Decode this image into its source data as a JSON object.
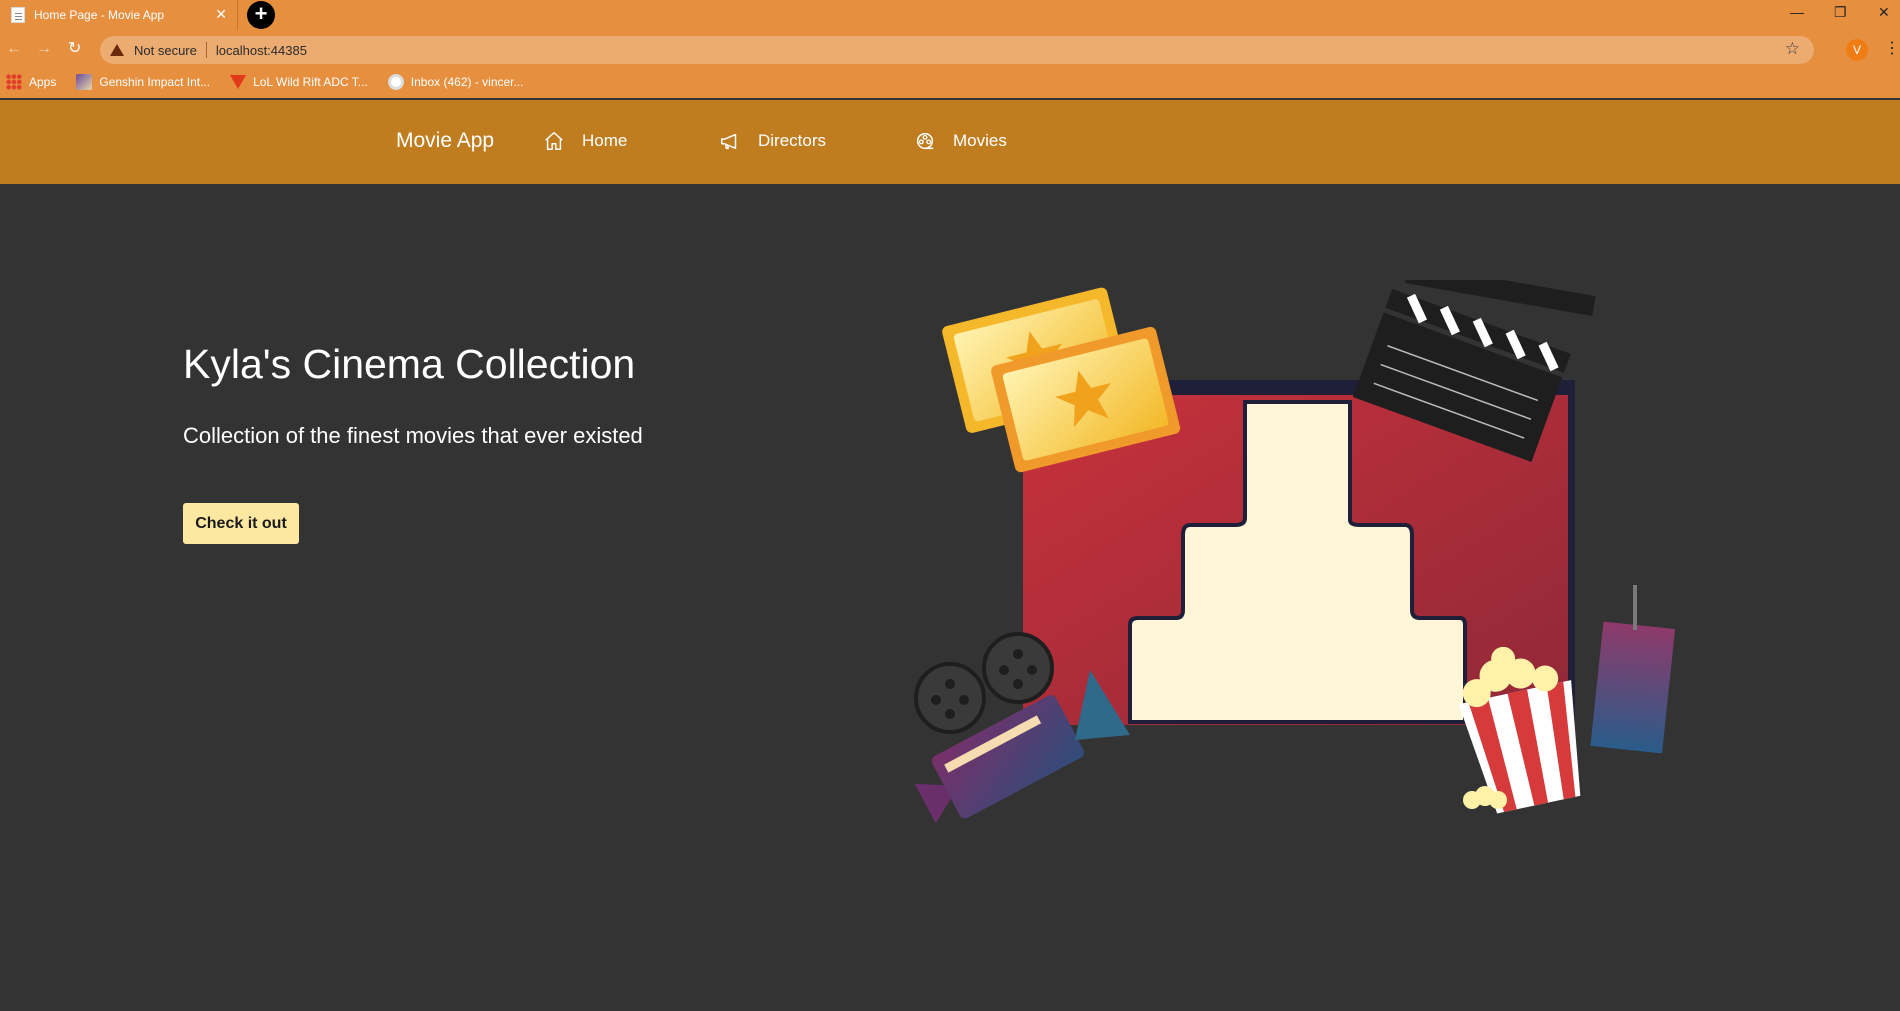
{
  "browser": {
    "tab_title": "Home Page - Movie App",
    "tab_close": "✕",
    "new_tab": "+",
    "not_secure": "Not secure",
    "url": "localhost:44385",
    "profile_initial": "V",
    "bookmarks": [
      {
        "label": "Apps",
        "icon": "apps-grid-icon"
      },
      {
        "label": "Genshin Impact Int...",
        "icon": "genshin-icon"
      },
      {
        "label": "LoL Wild Rift ADC T...",
        "icon": "wild-rift-icon"
      },
      {
        "label": "Inbox (462) - vincer...",
        "icon": "mail-icon"
      }
    ]
  },
  "nav": {
    "brand": "Movie App",
    "links": [
      {
        "label": "Home",
        "icon": "home-icon"
      },
      {
        "label": "Directors",
        "icon": "megaphone-icon"
      },
      {
        "label": "Movies",
        "icon": "film-reel-icon"
      }
    ]
  },
  "hero": {
    "title": "Kyla's Cinema Collection",
    "subtitle": "Collection of the finest movies that ever existed",
    "cta_label": "Check it out"
  },
  "colors": {
    "chrome": "#e58f3f",
    "header": "#bf7d20",
    "background": "#333333",
    "button": "#fde8a2"
  }
}
